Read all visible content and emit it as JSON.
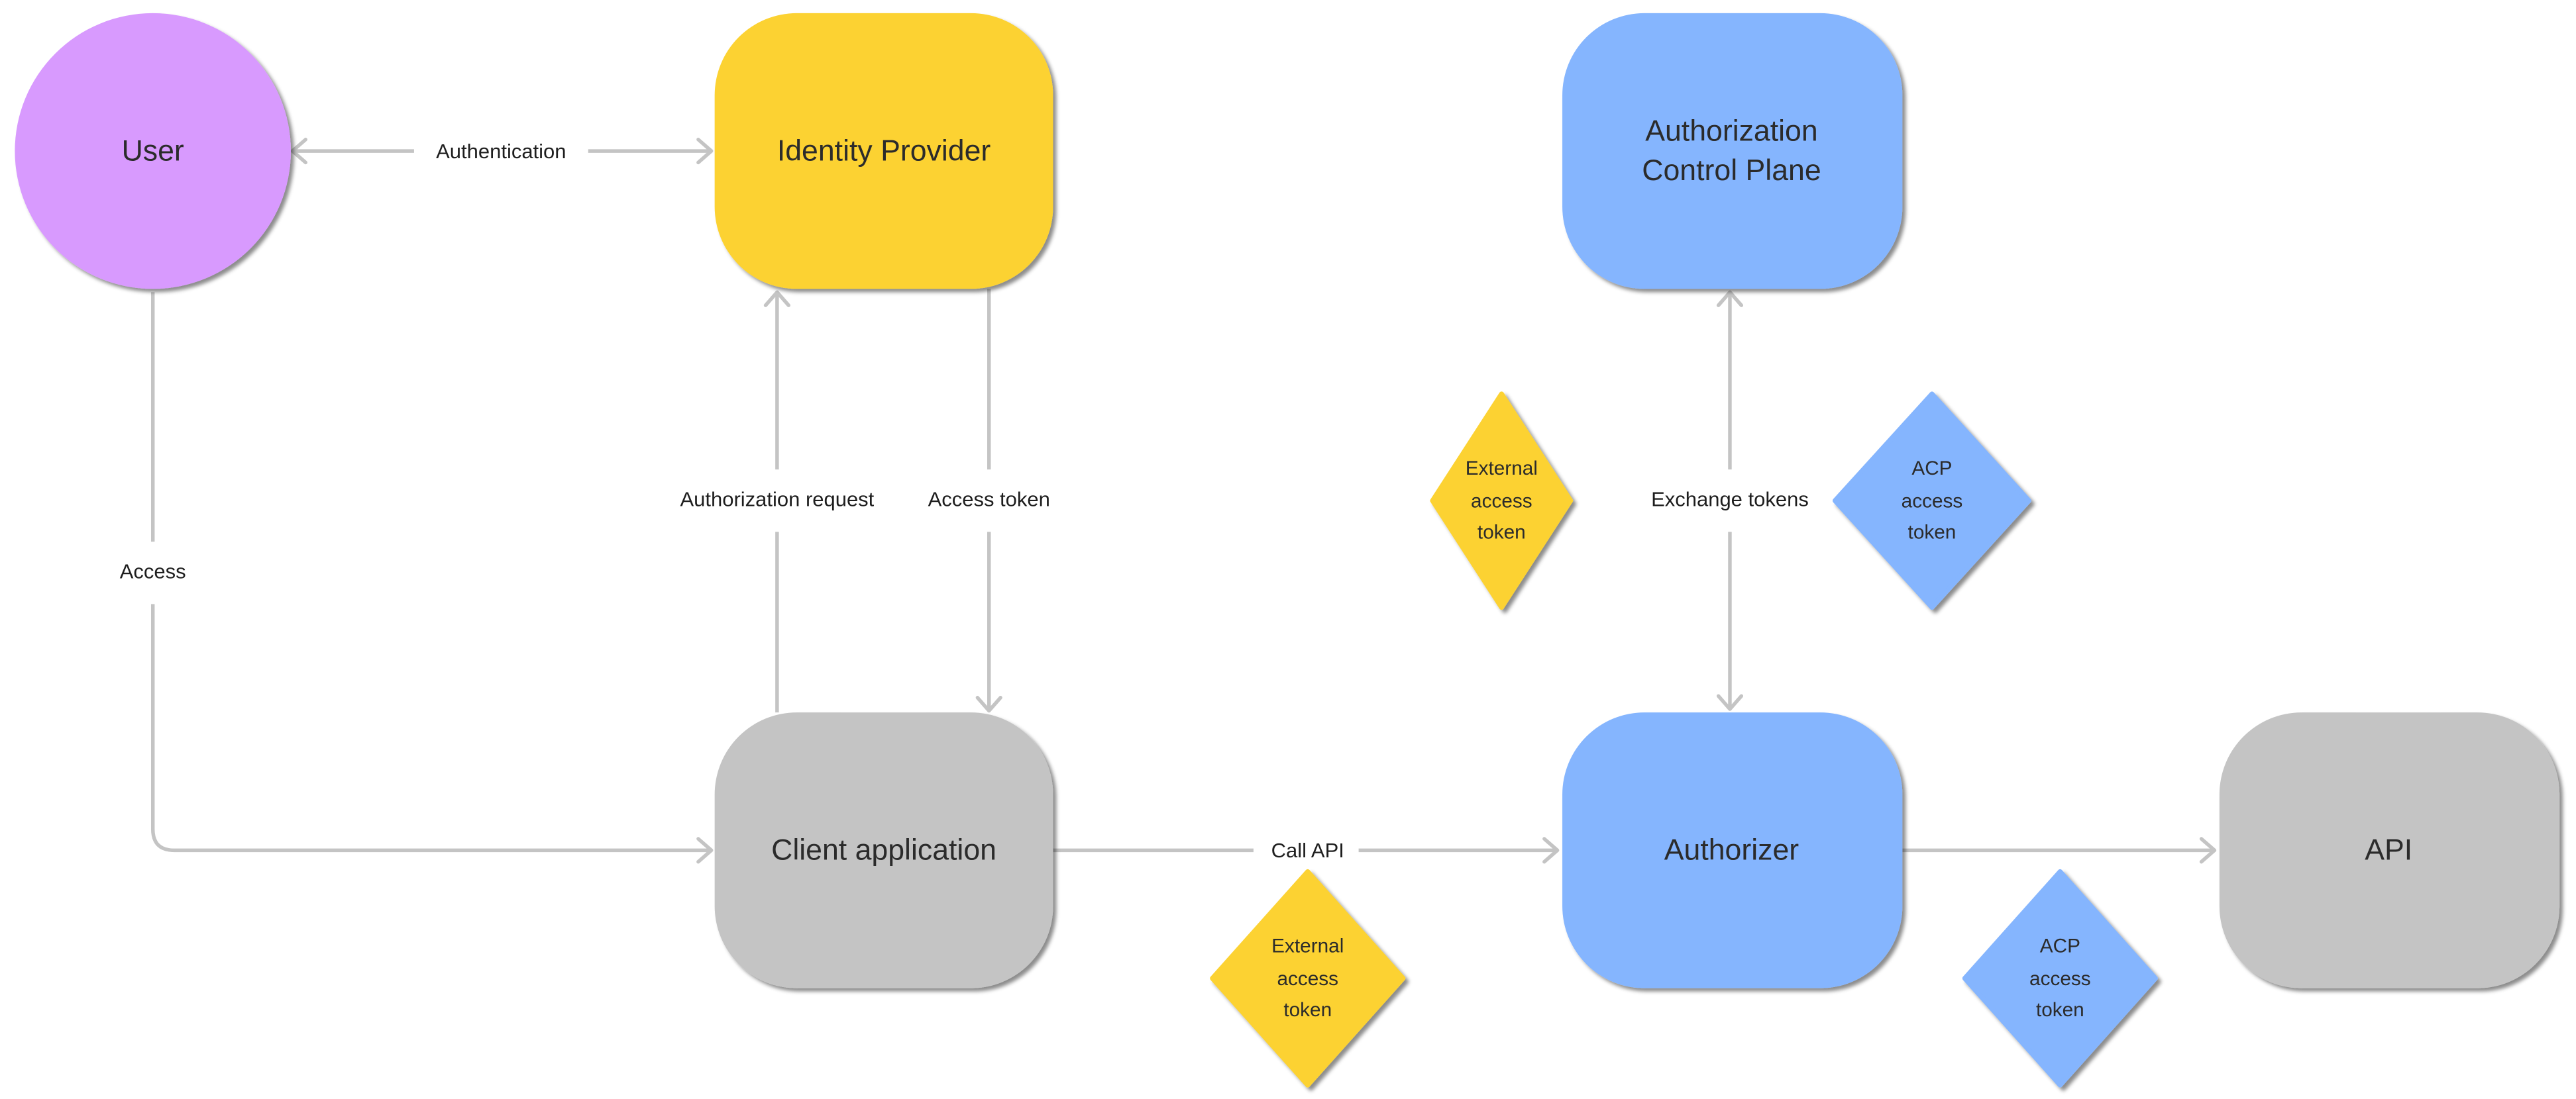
{
  "colors": {
    "user": "#d89afe",
    "identity": "#fcd232",
    "authz": "#85b5fe",
    "neutral": "#c4c4c4",
    "edge": "#c4c4c4",
    "text": "#2b2b2b"
  },
  "nodes": {
    "user": "User",
    "identity_provider": "Identity Provider",
    "acp_line1": "Authorization",
    "acp_line2": "Control Plane",
    "client": "Client application",
    "authorizer": "Authorizer",
    "api": "API"
  },
  "edges": {
    "authentication": "Authentication",
    "access": "Access",
    "authorization_request": "Authorization request",
    "access_token": "Access token",
    "exchange_tokens": "Exchange tokens",
    "call_api": "Call API"
  },
  "tokens": {
    "external_upper": [
      "External",
      "access",
      "token"
    ],
    "acp_upper": [
      "ACP",
      "access",
      "token"
    ],
    "external_lower": [
      "External",
      "access",
      "token"
    ],
    "acp_lower": [
      "ACP",
      "access",
      "token"
    ]
  }
}
